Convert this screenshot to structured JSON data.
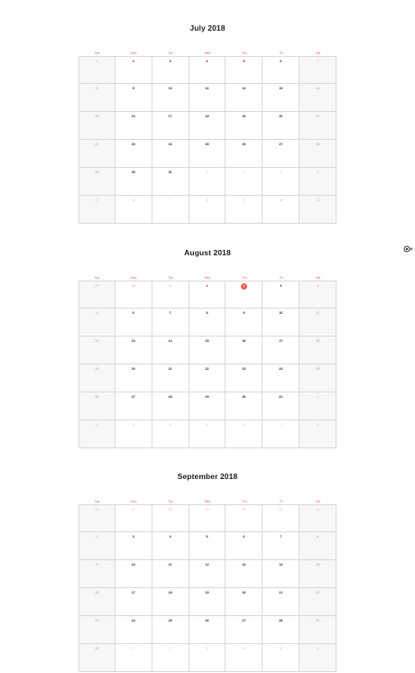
{
  "weekdays": [
    "Sun",
    "Mon",
    "Tue",
    "Wed",
    "Thu",
    "Fri",
    "Sat"
  ],
  "colors": {
    "accent": "#e9573f",
    "today": "#ea5a4a",
    "weekend_bg": "#f7f7f7",
    "grid_line": "#d9d9d9",
    "text": "#222222",
    "muted": "#bdbdbd"
  },
  "side_icon": "cookie-icon",
  "months": [
    {
      "title": "July 2018",
      "weeks": [
        [
          {
            "d": "1",
            "o": false
          },
          {
            "d": "2",
            "o": false
          },
          {
            "d": "3",
            "o": false
          },
          {
            "d": "4",
            "o": false
          },
          {
            "d": "5",
            "o": false
          },
          {
            "d": "6",
            "o": false
          },
          {
            "d": "7",
            "o": false
          }
        ],
        [
          {
            "d": "8",
            "o": false
          },
          {
            "d": "9",
            "o": false
          },
          {
            "d": "10",
            "o": false
          },
          {
            "d": "11",
            "o": false
          },
          {
            "d": "12",
            "o": false
          },
          {
            "d": "13",
            "o": false
          },
          {
            "d": "14",
            "o": false
          }
        ],
        [
          {
            "d": "15",
            "o": false
          },
          {
            "d": "16",
            "o": false
          },
          {
            "d": "17",
            "o": false
          },
          {
            "d": "18",
            "o": false
          },
          {
            "d": "19",
            "o": false
          },
          {
            "d": "20",
            "o": false
          },
          {
            "d": "21",
            "o": false
          }
        ],
        [
          {
            "d": "22",
            "o": false
          },
          {
            "d": "23",
            "o": false
          },
          {
            "d": "24",
            "o": false
          },
          {
            "d": "25",
            "o": false
          },
          {
            "d": "26",
            "o": false
          },
          {
            "d": "27",
            "o": false
          },
          {
            "d": "28",
            "o": false
          }
        ],
        [
          {
            "d": "29",
            "o": false
          },
          {
            "d": "30",
            "o": false
          },
          {
            "d": "31",
            "o": false
          },
          {
            "d": "1",
            "o": true
          },
          {
            "d": "2",
            "o": true
          },
          {
            "d": "3",
            "o": true
          },
          {
            "d": "4",
            "o": true
          }
        ],
        [
          {
            "d": "5",
            "o": true
          },
          {
            "d": "6",
            "o": true
          },
          {
            "d": "7",
            "o": true
          },
          {
            "d": "8",
            "o": true
          },
          {
            "d": "9",
            "o": true
          },
          {
            "d": "10",
            "o": true
          },
          {
            "d": "11",
            "o": true
          }
        ]
      ]
    },
    {
      "title": "August 2018",
      "weeks": [
        [
          {
            "d": "29",
            "o": true
          },
          {
            "d": "30",
            "o": true
          },
          {
            "d": "31",
            "o": true
          },
          {
            "d": "1",
            "o": false
          },
          {
            "d": "2",
            "o": false,
            "today": true
          },
          {
            "d": "3",
            "o": false
          },
          {
            "d": "4",
            "o": false
          }
        ],
        [
          {
            "d": "5",
            "o": false
          },
          {
            "d": "6",
            "o": false
          },
          {
            "d": "7",
            "o": false
          },
          {
            "d": "8",
            "o": false
          },
          {
            "d": "9",
            "o": false
          },
          {
            "d": "10",
            "o": false
          },
          {
            "d": "11",
            "o": false
          }
        ],
        [
          {
            "d": "12",
            "o": false
          },
          {
            "d": "13",
            "o": false
          },
          {
            "d": "14",
            "o": false
          },
          {
            "d": "15",
            "o": false
          },
          {
            "d": "16",
            "o": false
          },
          {
            "d": "17",
            "o": false
          },
          {
            "d": "18",
            "o": false
          }
        ],
        [
          {
            "d": "19",
            "o": false
          },
          {
            "d": "20",
            "o": false
          },
          {
            "d": "21",
            "o": false
          },
          {
            "d": "22",
            "o": false
          },
          {
            "d": "23",
            "o": false
          },
          {
            "d": "24",
            "o": false
          },
          {
            "d": "25",
            "o": false
          }
        ],
        [
          {
            "d": "26",
            "o": false
          },
          {
            "d": "27",
            "o": false
          },
          {
            "d": "28",
            "o": false
          },
          {
            "d": "29",
            "o": false
          },
          {
            "d": "30",
            "o": false
          },
          {
            "d": "31",
            "o": false
          },
          {
            "d": "1",
            "o": true
          }
        ],
        [
          {
            "d": "2",
            "o": true
          },
          {
            "d": "3",
            "o": true
          },
          {
            "d": "4",
            "o": true
          },
          {
            "d": "5",
            "o": true
          },
          {
            "d": "6",
            "o": true
          },
          {
            "d": "7",
            "o": true
          },
          {
            "d": "8",
            "o": true
          }
        ]
      ]
    },
    {
      "title": "September 2018",
      "weeks": [
        [
          {
            "d": "26",
            "o": true
          },
          {
            "d": "27",
            "o": true
          },
          {
            "d": "28",
            "o": true
          },
          {
            "d": "29",
            "o": true
          },
          {
            "d": "30",
            "o": true
          },
          {
            "d": "31",
            "o": true
          },
          {
            "d": "1",
            "o": false
          }
        ],
        [
          {
            "d": "2",
            "o": false
          },
          {
            "d": "3",
            "o": false
          },
          {
            "d": "4",
            "o": false
          },
          {
            "d": "5",
            "o": false
          },
          {
            "d": "6",
            "o": false
          },
          {
            "d": "7",
            "o": false
          },
          {
            "d": "8",
            "o": false
          }
        ],
        [
          {
            "d": "9",
            "o": false
          },
          {
            "d": "10",
            "o": false
          },
          {
            "d": "11",
            "o": false
          },
          {
            "d": "12",
            "o": false
          },
          {
            "d": "13",
            "o": false
          },
          {
            "d": "14",
            "o": false
          },
          {
            "d": "15",
            "o": false
          }
        ],
        [
          {
            "d": "16",
            "o": false
          },
          {
            "d": "17",
            "o": false
          },
          {
            "d": "18",
            "o": false
          },
          {
            "d": "19",
            "o": false
          },
          {
            "d": "20",
            "o": false
          },
          {
            "d": "21",
            "o": false
          },
          {
            "d": "22",
            "o": false
          }
        ],
        [
          {
            "d": "23",
            "o": false
          },
          {
            "d": "24",
            "o": false
          },
          {
            "d": "25",
            "o": false
          },
          {
            "d": "26",
            "o": false
          },
          {
            "d": "27",
            "o": false
          },
          {
            "d": "28",
            "o": false
          },
          {
            "d": "29",
            "o": false
          }
        ],
        [
          {
            "d": "30",
            "o": false
          },
          {
            "d": "1",
            "o": true
          },
          {
            "d": "2",
            "o": true
          },
          {
            "d": "3",
            "o": true
          },
          {
            "d": "4",
            "o": true
          },
          {
            "d": "5",
            "o": true
          },
          {
            "d": "6",
            "o": true
          }
        ]
      ]
    }
  ]
}
